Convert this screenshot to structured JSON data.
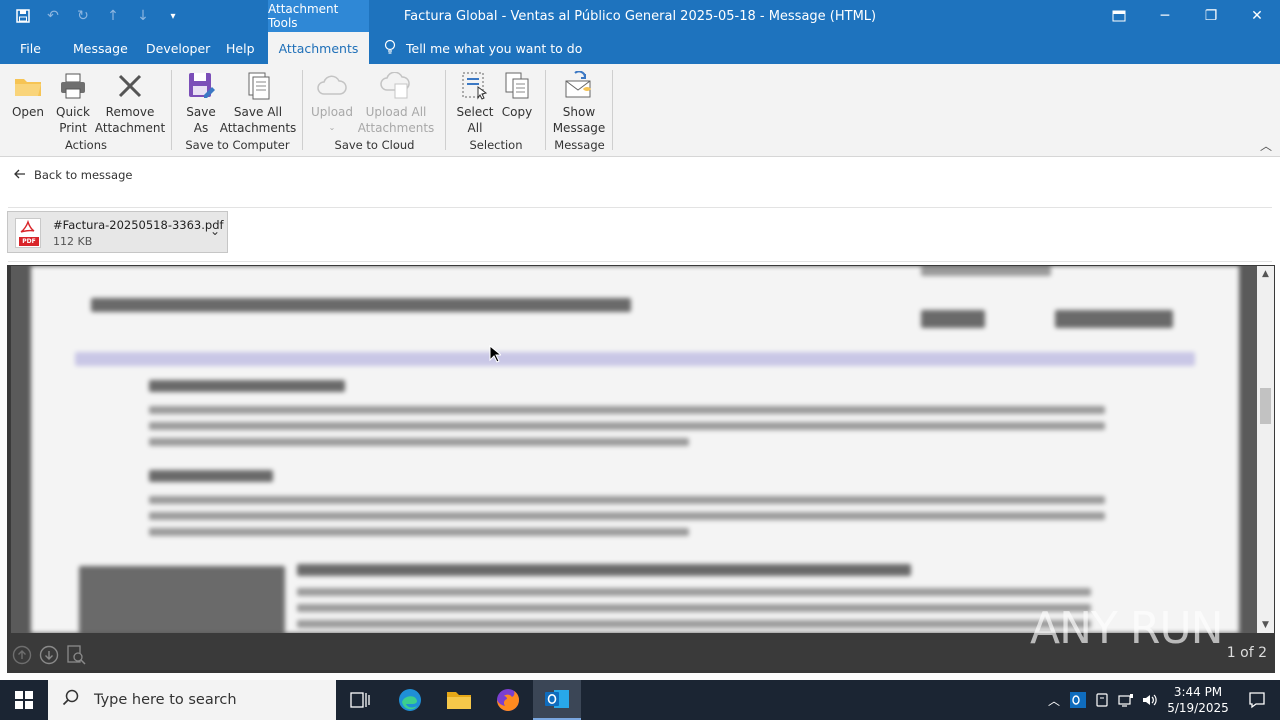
{
  "window": {
    "title": "Factura Global - Ventas al Público General 2025-05-18  -  Message (HTML)",
    "context_tab": "Attachment Tools"
  },
  "ribbon_tabs": [
    "File",
    "Message",
    "Developer",
    "Help",
    "Attachments"
  ],
  "active_tab": "Attachments",
  "tell_me": "Tell me what you want to do",
  "groups": {
    "actions": {
      "label": "Actions",
      "open": "Open",
      "quick_print": [
        "Quick",
        "Print"
      ],
      "remove": [
        "Remove",
        "Attachment"
      ]
    },
    "save_to_computer": {
      "label": "Save to Computer",
      "save_as": [
        "Save",
        "As"
      ],
      "save_all": [
        "Save All",
        "Attachments"
      ]
    },
    "save_to_cloud": {
      "label": "Save to Cloud",
      "upload": "Upload",
      "upload_all": [
        "Upload All",
        "Attachments"
      ]
    },
    "selection": {
      "label": "Selection",
      "select_all": [
        "Select",
        "All"
      ],
      "copy": "Copy"
    },
    "message": {
      "label": "Message",
      "show_message": [
        "Show",
        "Message"
      ]
    }
  },
  "back_link": "Back to message",
  "attachment": {
    "filename": "#Factura-20250518-3363.pdf",
    "size": "112 KB",
    "type_label": "PDF"
  },
  "preview": {
    "page_indicator": "1 of 2"
  },
  "watermark": "ANY RUN",
  "taskbar": {
    "search_placeholder": "Type here to search",
    "time": "3:44 PM",
    "date": "5/19/2025"
  },
  "colors": {
    "accent": "#1e73be",
    "context_tab": "#2f88d6",
    "taskbar": "#1b2533"
  }
}
